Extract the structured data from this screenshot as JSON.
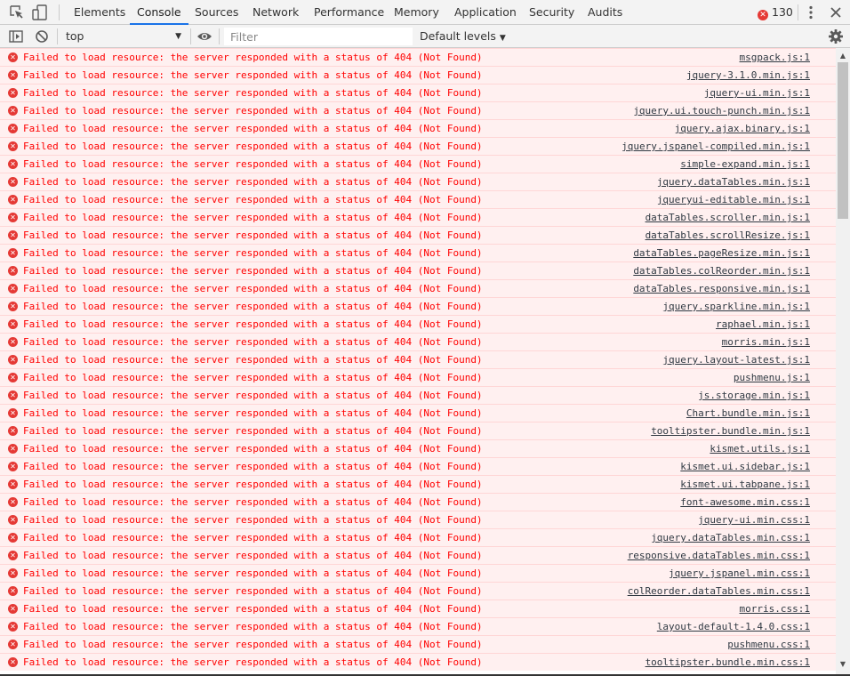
{
  "tabs": [
    "Elements",
    "Console",
    "Sources",
    "Network",
    "Performance",
    "Memory",
    "Application",
    "Security",
    "Audits"
  ],
  "active_tab": "Console",
  "error_count": "130",
  "toolbar": {
    "context": "top",
    "filter_placeholder": "Filter",
    "levels_label": "Default levels"
  },
  "message_text": "Failed to load resource: the server responded with a status of 404 (Not Found)",
  "rows": [
    {
      "src": "msgpack.js:1"
    },
    {
      "src": "jquery-3.1.0.min.js:1"
    },
    {
      "src": "jquery-ui.min.js:1"
    },
    {
      "src": "jquery.ui.touch-punch.min.js:1"
    },
    {
      "src": "jquery.ajax.binary.js:1"
    },
    {
      "src": "jquery.jspanel-compiled.min.js:1"
    },
    {
      "src": "simple-expand.min.js:1"
    },
    {
      "src": "jquery.dataTables.min.js:1"
    },
    {
      "src": "jqueryui-editable.min.js:1"
    },
    {
      "src": "dataTables.scroller.min.js:1"
    },
    {
      "src": "dataTables.scrollResize.js:1"
    },
    {
      "src": "dataTables.pageResize.min.js:1"
    },
    {
      "src": "dataTables.colReorder.min.js:1"
    },
    {
      "src": "dataTables.responsive.min.js:1"
    },
    {
      "src": "jquery.sparkline.min.js:1"
    },
    {
      "src": "raphael.min.js:1"
    },
    {
      "src": "morris.min.js:1"
    },
    {
      "src": "jquery.layout-latest.js:1"
    },
    {
      "src": "pushmenu.js:1"
    },
    {
      "src": "js.storage.min.js:1"
    },
    {
      "src": "Chart.bundle.min.js:1"
    },
    {
      "src": "tooltipster.bundle.min.js:1"
    },
    {
      "src": "kismet.utils.js:1"
    },
    {
      "src": "kismet.ui.sidebar.js:1"
    },
    {
      "src": "kismet.ui.tabpane.js:1"
    },
    {
      "src": "font-awesome.min.css:1"
    },
    {
      "src": "jquery-ui.min.css:1"
    },
    {
      "src": "jquery.dataTables.min.css:1"
    },
    {
      "src": "responsive.dataTables.min.css:1"
    },
    {
      "src": "jquery.jspanel.min.css:1"
    },
    {
      "src": "colReorder.dataTables.min.css:1"
    },
    {
      "src": "morris.css:1"
    },
    {
      "src": "layout-default-1.4.0.css:1"
    },
    {
      "src": "pushmenu.css:1"
    },
    {
      "src": "tooltipster.bundle.min.css:1"
    }
  ],
  "icons": {
    "inspect": "inspect-element-icon",
    "device": "device-toolbar-icon",
    "menu": "more-vertical-icon",
    "close": "close-icon",
    "sidebar": "console-sidebar-icon",
    "clear": "clear-console-icon",
    "eye": "live-expression-eye-icon",
    "settings": "gear-icon"
  },
  "colors": {
    "error_text": "#ff0000",
    "error_bg": "#fff0f0",
    "error_border": "#ffd6d6",
    "error_icon": "#e53935",
    "tab_accent": "#1a73e8",
    "toolbar_bg": "#f3f3f3"
  }
}
